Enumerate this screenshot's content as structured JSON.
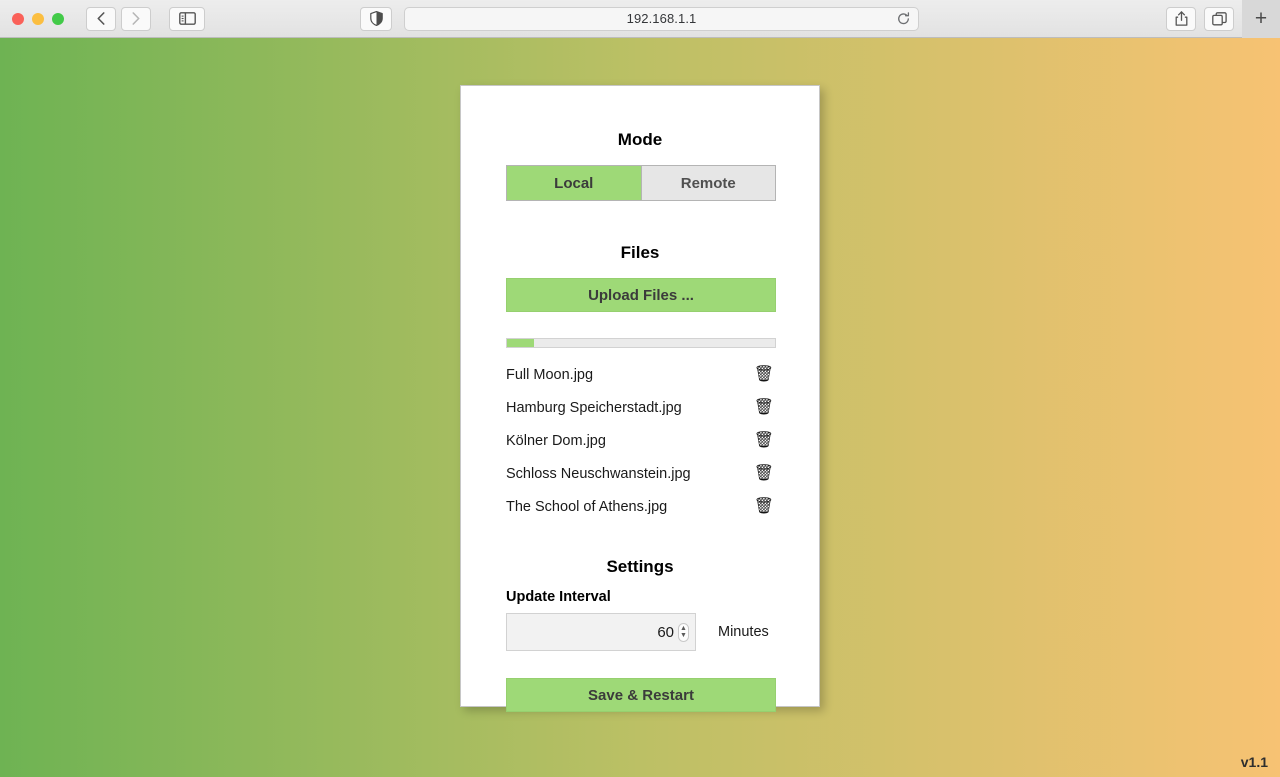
{
  "browser": {
    "url": "192.168.1.1",
    "back_icon": "chevron-left-icon",
    "forward_icon": "chevron-right-icon",
    "sidebar_icon": "sidebar-toggle-icon",
    "shield_icon": "privacy-shield-icon",
    "reload_icon": "reload-icon",
    "share_icon": "share-icon",
    "tabs_icon": "tab-overview-icon",
    "new_tab_label": "+"
  },
  "page": {
    "mode": {
      "heading": "Mode",
      "options": [
        {
          "label": "Local",
          "selected": true
        },
        {
          "label": "Remote",
          "selected": false
        }
      ]
    },
    "files": {
      "heading": "Files",
      "upload_label": "Upload Files ...",
      "progress_percent": 10,
      "delete_icon": "🗑",
      "items": [
        {
          "name": "Full Moon.jpg"
        },
        {
          "name": "Hamburg Speicherstadt.jpg"
        },
        {
          "name": "Kölner Dom.jpg"
        },
        {
          "name": "Schloss Neuschwanstein.jpg"
        },
        {
          "name": "The School of Athens.jpg"
        }
      ]
    },
    "settings": {
      "heading": "Settings",
      "interval_label": "Update Interval",
      "interval_value": "60",
      "interval_unit": "Minutes",
      "stepper_up": "▲",
      "stepper_down": "▼",
      "save_label": "Save & Restart"
    },
    "version": "v1.1"
  },
  "colors": {
    "accent_green": "#9ed977",
    "bg_gradient_start": "#6eb353",
    "bg_gradient_mid": "#bcc065",
    "bg_gradient_end": "#f7c273"
  }
}
